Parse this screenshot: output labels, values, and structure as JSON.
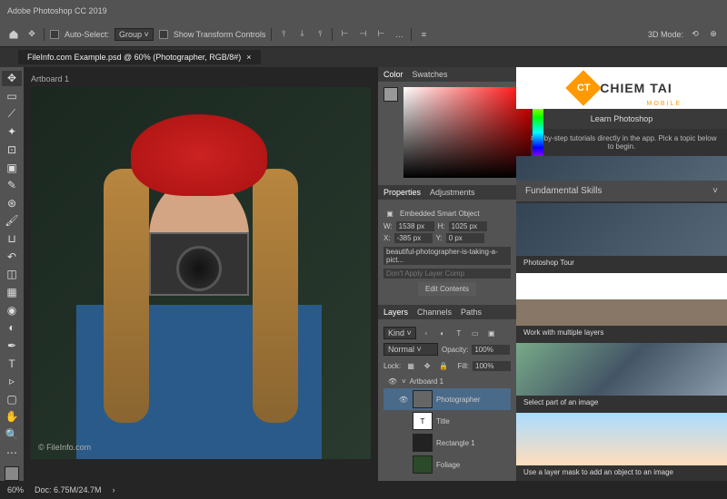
{
  "app": {
    "title": "Adobe Photoshop CC 2019"
  },
  "optbar": {
    "auto_select": "Auto-Select:",
    "group": "Group",
    "show_transform": "Show Transform Controls",
    "mode_3d": "3D Mode:"
  },
  "tab": {
    "name": "FileInfo.com Example.psd @ 60% (Photographer, RGB/8#)",
    "close": "×"
  },
  "artboard": "Artboard 1",
  "watermark": "© FileInfo.com",
  "panels": {
    "color": {
      "tabs": [
        "Color",
        "Swatches"
      ]
    },
    "props": {
      "tabs": [
        "Properties",
        "Adjustments"
      ],
      "type": "Embedded Smart Object",
      "w_label": "W:",
      "w": "1538 px",
      "h_label": "H:",
      "h": "1025 px",
      "x_label": "X:",
      "x": "-385 px",
      "y_label": "Y:",
      "y": "0 px",
      "filename": "beautiful-photographer-is-taking-a-pict...",
      "comp": "Don't Apply Layer Comp",
      "edit": "Edit Contents"
    },
    "layers": {
      "tabs": [
        "Layers",
        "Channels",
        "Paths"
      ],
      "kind": "Kind",
      "blend": "Normal",
      "opacity_label": "Opacity:",
      "opacity": "100%",
      "lock": "Lock:",
      "fill_label": "Fill:",
      "fill": "100%",
      "items": [
        {
          "name": "Artboard 1",
          "artboard": true
        },
        {
          "name": "Photographer"
        },
        {
          "name": "Title"
        },
        {
          "name": "Rectangle 1"
        },
        {
          "name": "Foliage"
        }
      ]
    }
  },
  "learn": {
    "logo": {
      "badge": "CT",
      "name": "CHIEM TAI",
      "sub": "MOBILE"
    },
    "title": "Learn Photoshop",
    "desc": "Step-by-step tutorials directly in the app. Pick a topic below to begin.",
    "section": "Fundamental Skills",
    "cards": [
      {
        "title": "Photoshop Tour"
      },
      {
        "title": "Work with multiple layers"
      },
      {
        "title": "Select part of an image"
      },
      {
        "title": "Use a layer mask to add an object to an image"
      }
    ]
  },
  "status": {
    "zoom": "60%",
    "doc": "Doc: 6.75M/24.7M"
  }
}
